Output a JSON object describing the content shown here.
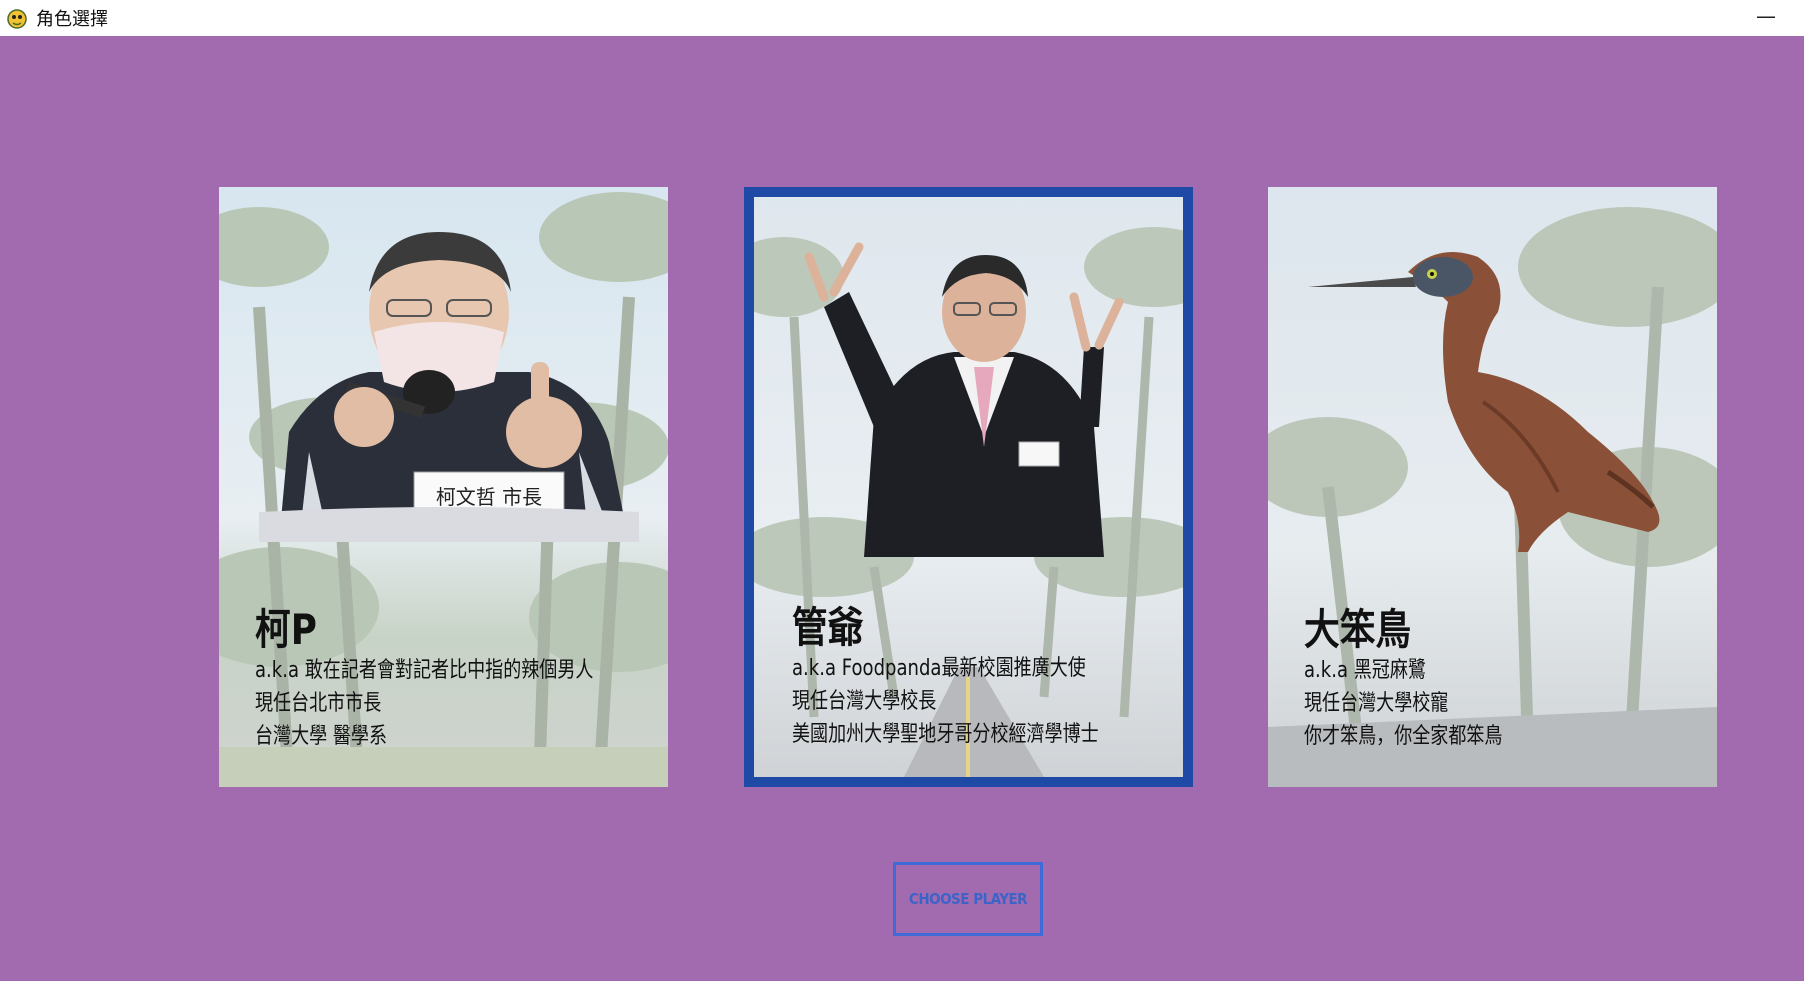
{
  "window": {
    "title": "角色選擇",
    "minimize_label": "—",
    "background": "#a36baf",
    "icon": "snake-game-icon"
  },
  "cards": [
    {
      "name": "柯P",
      "lines": [
        "a.k.a 敢在記者會對記者比中指的辣個男人",
        "現任台北市市長",
        "台灣大學 醫學系"
      ],
      "nameplate": "柯文哲  市長",
      "selected": false
    },
    {
      "name": "管爺",
      "lines": [
        "a.k.a Foodpanda最新校園推廣大使",
        "現任台灣大學校長",
        "美國加州大學聖地牙哥分校經濟學博士"
      ],
      "selected": true,
      "selected_border_color": "#1e4aa5"
    },
    {
      "name": "大笨鳥",
      "lines": [
        "a.k.a 黑冠麻鷺",
        "現任台灣大學校寵",
        "你才笨鳥，你全家都笨鳥"
      ],
      "selected": false
    }
  ],
  "choose_button": {
    "label": "CHOOSE PLAYER",
    "border_color": "#3f6ad8",
    "text_color": "#3c64c8"
  }
}
